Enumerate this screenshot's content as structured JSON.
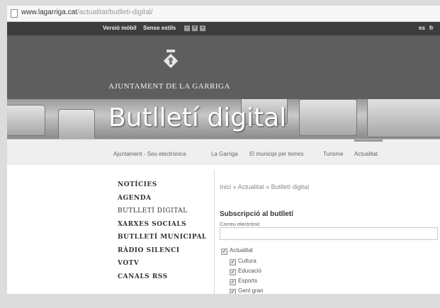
{
  "browser": {
    "url_host": "www.lagarriga.cat",
    "url_path": "/actualitat/butlleti-digital/"
  },
  "topbar": {
    "mobile_label": "Versió mòbil",
    "nostyles_label": "Sense estils",
    "size_minus": "−",
    "size_equal": "=",
    "size_plus": "+",
    "lang_es": "es",
    "lang_fr": "fr"
  },
  "header": {
    "org_name": "AJUNTAMENT DE LA GARRIGA"
  },
  "banner": {
    "title": "Butlletí digital"
  },
  "nav": {
    "items": [
      "Ajuntament - Seu electrònica",
      "La Garriga",
      "El municipi per temes",
      "Turisme",
      "Actualitat"
    ]
  },
  "sidebar": {
    "items": [
      "NOTÍCIES",
      "AGENDA",
      "BUTLLETÍ DIGITAL",
      "XARXES SOCIALS",
      "BUTLLETÍ MUNICIPAL",
      "RÀDIO SILENCI",
      "VOTV",
      "CANALS RSS"
    ]
  },
  "breadcrumb": {
    "home": "Inici",
    "section": "Actualitat",
    "current": "Butlletí digital",
    "sep": "»"
  },
  "form": {
    "heading": "Subscripció al butlletí",
    "email_label": "Correu electrònic",
    "email_value": "",
    "parent_option": "Actualitat",
    "options": [
      "Cultura",
      "Educació",
      "Esports",
      "Gent gran"
    ]
  }
}
